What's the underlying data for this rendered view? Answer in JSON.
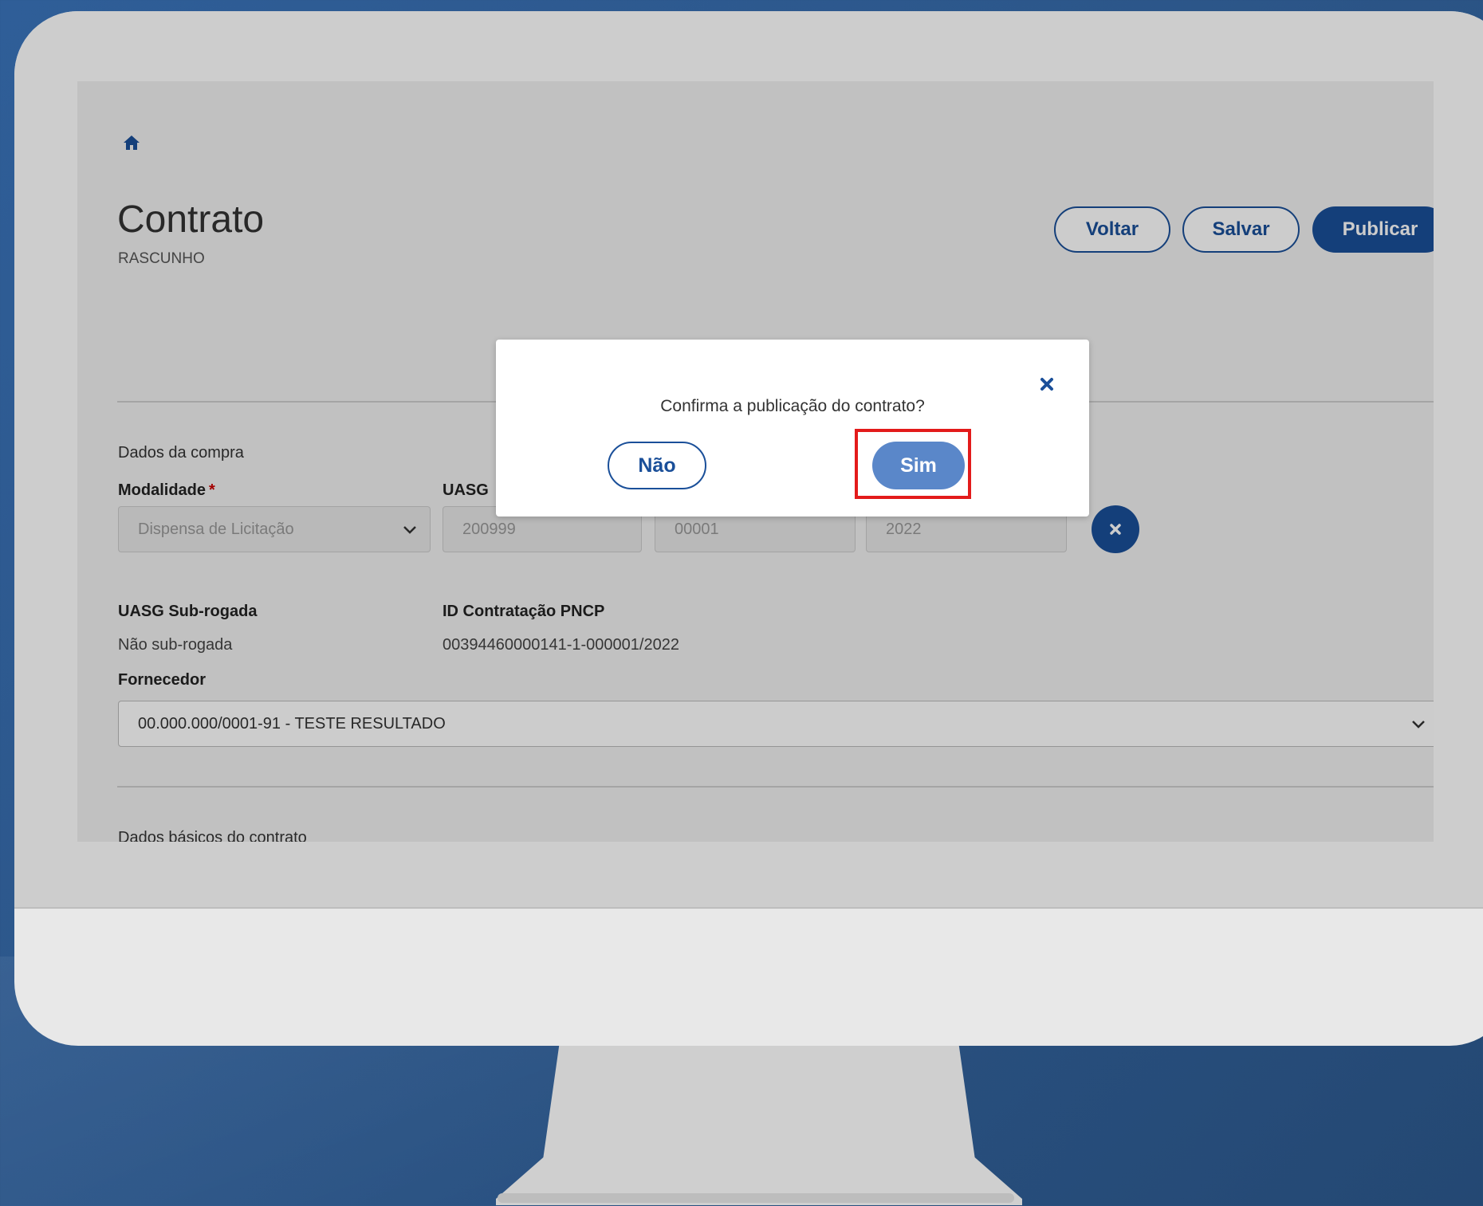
{
  "page": {
    "title": "Contrato",
    "status": "RASCUNHO",
    "actions": {
      "voltar": "Voltar",
      "salvar": "Salvar",
      "publicar": "Publicar"
    }
  },
  "compra": {
    "section_title": "Dados da compra",
    "modalidade_label": "Modalidade",
    "modalidade_required": "*",
    "modalidade_value": "Dispensa de Licitação",
    "uasg_label": "UASG",
    "uasg_value": "200999",
    "numero_value": "00001",
    "ano_value": "2022",
    "sub_rogada_label": "UASG Sub-rogada",
    "sub_rogada_value": "Não sub-rogada",
    "pncp_label": "ID Contratação PNCP",
    "pncp_value": "00394460000141-1-000001/2022",
    "fornecedor_label": "Fornecedor",
    "fornecedor_value": "00.000.000/0001-91 - TESTE RESULTADO"
  },
  "contrato": {
    "section_title": "Dados básicos do contrato"
  },
  "modal": {
    "message": "Confirma a publicação do contrato?",
    "no_label": "Não",
    "yes_label": "Sim"
  },
  "colors": {
    "primary": "#1a4f99",
    "highlight": "#e31b1b",
    "sim_button": "#5a87c9"
  },
  "icons": [
    "home-icon",
    "chevron-down-icon",
    "close-icon"
  ]
}
